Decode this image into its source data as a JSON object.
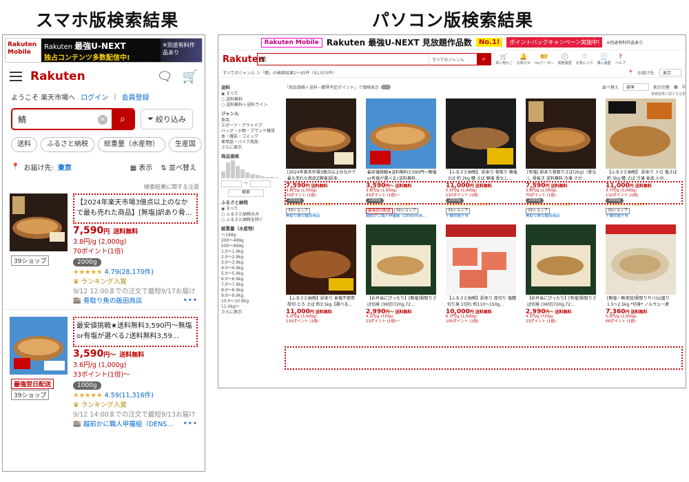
{
  "titles": {
    "mobile": "スマホ版検索結果",
    "pc": "パソコン版検索結果"
  },
  "mobile": {
    "banner": {
      "left": "Rakuten Mobile",
      "brand": "Rakuten",
      "main": "最強U-NEXT",
      "sub": "独占コンテンツ多数配信中!",
      "right": "※別途有料作品あり"
    },
    "logo": "Rakuten",
    "welcome": "ようこそ 楽天市場へ",
    "login": "ログイン",
    "register": "会員登録",
    "search_value": "鯖",
    "filter_label": "絞り込み",
    "chips": [
      "送料",
      "ふるさと納税",
      "総重量（水産物）",
      "生産国",
      "品"
    ],
    "delivery_label": "お届け先:",
    "delivery_area": "東京",
    "display": "表示",
    "sort": "並べ替え",
    "note": "検索結果に関する注意",
    "items": [
      {
        "title": "【2024年楽天市場3億点以上のなかで最も売れた商品】[無塩]訳あり骨…",
        "price": "7,590",
        "yen": "円",
        "shipping": "送料無料",
        "unit": "3.8円/g (2,000g)",
        "points": "70ポイント(1倍)",
        "shop_tag": "39ショップ",
        "weight": "2000g",
        "stars": "★★★★★",
        "rating": "4.79",
        "reviews": "(28,170件)",
        "ranking": "ランキング入賞",
        "order": "9/12 12:00までの注文で最短9/17お届け",
        "shop": "骨取り魚の飯田商店"
      },
      {
        "title": "最安値挑戦★送料無料3,590円〜無塩or有塩が選べる♪送料無料3,59…",
        "price": "3,590",
        "yen": "円〜",
        "shipping": "送料無料",
        "unit": "3.6円/g (1,000g)",
        "points": "33ポイント(1倍)〜",
        "red_tag": "最強翌日配送",
        "shop_tag": "39ショップ",
        "weight": "1000g",
        "stars": "★★★★★",
        "rating": "4.59",
        "reviews": "(11,316件)",
        "ranking": "ランキング入賞",
        "order": "9/12 14:00までの注文で最短9/13お届け",
        "shop": "越前かに職人甲羅組（DENS…"
      }
    ]
  },
  "pc": {
    "banner": {
      "left": "Rakuten Mobile",
      "main": "Rakuten 最強U-NEXT 見放題作品数",
      "no1": "No.1!",
      "point": "ポイントバックキャンペーン実施中!",
      "right": "※別途有料作品あり"
    },
    "logo": "Rakuten",
    "search_value": "鯖",
    "genre": "すべてのジャンル",
    "icons": [
      "買い物かご",
      "お知らせ",
      "myクーポン",
      "閲覧履歴",
      "お気に入り",
      "購入履歴",
      "ヘルプ"
    ],
    "breadcrumb": "すべてのジャンル ＞「鯖」の検索結果1〜45件（91,975件）",
    "deliver_to": "お届け先:",
    "area": "東京",
    "sidebar": {
      "shipping": "送料",
      "ship_opts": [
        "すべて",
        "送料無料",
        "送料無料＋送料ライン"
      ],
      "genre": "ジャンル",
      "genres": [
        "食品",
        "スポーツ・アウトドア",
        "バッグ・小物・ブランド雑貨",
        "本・雑誌・コミック",
        "車用品・バイク用品",
        "さらに表示"
      ],
      "price": "商品価格",
      "search_btn": "検索",
      "furusato": "ふるさと納税",
      "furusato_opts": [
        "すべて",
        "ふるさと納税のみ",
        "ふるさと納税を除く"
      ],
      "weight": "総重量（水産物）",
      "weights": [
        "〜199g",
        "200〜499g",
        "500〜999g",
        "1.0〜1.9kg",
        "2.0〜2.9kg",
        "3.0〜3.9kg",
        "4.0〜4.9kg",
        "5.0〜5.9kg",
        "6.0〜6.9kg",
        "7.0〜7.9kg",
        "8.0〜8.9kg",
        "9.0〜9.9kg",
        "10.0〜10.9kg",
        "11.0kg〜",
        "さらに表示"
      ]
    },
    "content_top": "「商品価格＋送料−獲得予定ポイント」で価格表示",
    "sort_label": "並べ替え",
    "sort_value": "標準",
    "display_label": "表示切替",
    "note": "検索結果に関する注意",
    "row1": [
      {
        "title": "[2024年楽天市場3億点以上のなかで最も売れた商品][無塩]訳あ…",
        "price": "7,590",
        "unit": "3.8円/g (2,000g)",
        "points": "70ポイント (1倍)",
        "weight": "2000g",
        "rating": "★★★★★4.79 (28,170件)",
        "shop": "骨取り魚の飯田商店"
      },
      {
        "title": "最安値挑戦★送料無料3,590円〜無塩or有塩が選べる♪送料無料…",
        "price": "3,590",
        "unit": "3.6円/g (1,000g)",
        "points": "33ポイント (1倍)〜",
        "weight": "1000g",
        "rating": "★★★★★4.59 (11,316件)",
        "shop": "越前かに職人甲羅組（DENSHOK…"
      },
      {
        "title": "【ふるさと納税】 訳あり 骨取り 無塩 さば 約 2kg 鯖 さば 無塩 骨なし…",
        "price": "11,000",
        "unit": "5.5円/g (2,000g)",
        "points": "110ポイント (1倍)",
        "weight": "2000g",
        "rating": "★★★★★4.82 (1,066件)",
        "shop": "千葉県銚子市"
      },
      {
        "title": "[有塩] 訳あり骨取りさば(2kg)（骨なし 骨抜き 送料無料 冷凍 さか…",
        "price": "7,590",
        "unit": "3.8円/g (2,000g)",
        "points": "70ポイント (1倍)",
        "weight": "2000g",
        "rating": "★★★★★4.77 (15,156件)",
        "shop": "骨取り魚の飯田商店"
      },
      {
        "title": "【ふるさと納税】 訳あり トロ 塩さば 約 3kg 鯖 さば 冷凍 食品 小分…",
        "price": "11,000",
        "unit": "3.7円/g (3,000g)",
        "points": "110ポイント (1倍)",
        "weight": "3000g",
        "rating": "★★★★★4.74 (865件)",
        "shop": "千葉県銚子市"
      }
    ],
    "row2": [
      {
        "title": "【ふるさと納税】訳あり 食塩不使用 厚切 とろ さば 約3.5kg【選べる…",
        "price": "11,000",
        "unit": "3.2円/g (3,500g)",
        "points": "110ポイント (1倍)"
      },
      {
        "title": "【お弁当にぴったり】[無塩]骨取りさば切身 (36切)720g,72…",
        "price": "2,990",
        "unit": "4.1円/g (720g)",
        "points": "23ポイント (1倍)〜"
      },
      {
        "title": "【ふるさと納税】訳あり 厚切り 塩鯖 切り身 1切れ 約110〜150g…",
        "price": "10,000",
        "unit": "6.7円/g (1,500g)",
        "points": "100ポイント (1倍)"
      },
      {
        "title": "【お弁当にぴったり】[有塩]骨取りさば切身 (36切)720g,72…",
        "price": "2,990",
        "unit": "4.1円/g (720g)",
        "points": "23ポイント (1倍)"
      },
      {
        "title": "[無塩・無添加]骨取りサバ(山盛り1.5〜2.5kg *切身* ノルウェー産 イ…",
        "price": "7,360",
        "unit": "5.0円/g (1,500g)",
        "points": "68ポイント (1倍)"
      }
    ]
  },
  "colors": {
    "accent": "#bf0000",
    "link": "#0066cc",
    "dotted": "#cc0000",
    "star": "#f5a623"
  }
}
